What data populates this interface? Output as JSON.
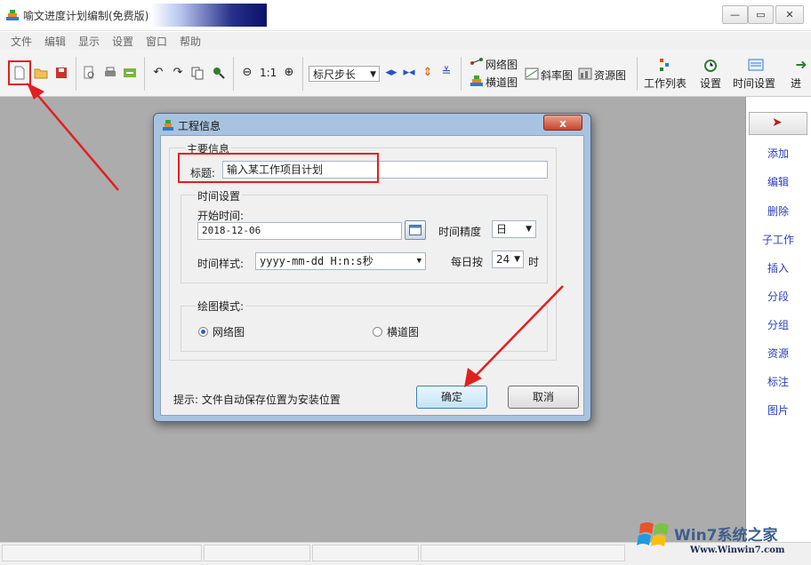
{
  "window": {
    "title": "喻文进度计划编制(免费版)",
    "minimize_symbol": "—",
    "restore_symbol": "▭",
    "close_symbol": "✕"
  },
  "menu": [
    "文件",
    "编辑",
    "显示",
    "设置",
    "窗口",
    "帮助"
  ],
  "toolbar": {
    "zoom_1to1": "1:1",
    "ruler_select": "标尺步长",
    "network_chart": "网络图",
    "lane_chart": "横道图",
    "slope_chart": "斜率图",
    "resource_chart": "资源图",
    "work_list": "工作列表",
    "settings": "设置",
    "time_settings": "时间设置",
    "next": "进"
  },
  "right_panel": {
    "items": [
      "添加",
      "编辑",
      "删除",
      "子工作",
      "插入",
      "分段",
      "分组",
      "资源",
      "标注",
      "图片"
    ]
  },
  "dialog": {
    "title": "工程信息",
    "close_label": "x",
    "main_group_label": "主要信息",
    "title_label": "标题:",
    "title_value": "输入某工作项目计划",
    "time_group_label": "时间设置",
    "start_time_label": "开始时间:",
    "start_time_value": "2018-12-06",
    "precision_label": "时间精度",
    "precision_value": "日",
    "time_format_label": "时间样式:",
    "time_format_value": "yyyy-mm-dd H:n:s秒",
    "daily_label": "每日按",
    "daily_value": "24",
    "daily_unit": "时",
    "draw_mode_label": "绘图模式:",
    "mode_network": "网络图",
    "mode_lane": "横道图",
    "hint": "提示: 文件自动保存位置为安装位置",
    "ok_label": "确定",
    "cancel_label": "取消"
  },
  "watermark": {
    "brand": "Win7系统之家",
    "url": "Www.Winwin7.com"
  },
  "colors": {
    "accent": "#e02020",
    "panel_link": "#2a3fb8",
    "workspace": "#acacac"
  }
}
